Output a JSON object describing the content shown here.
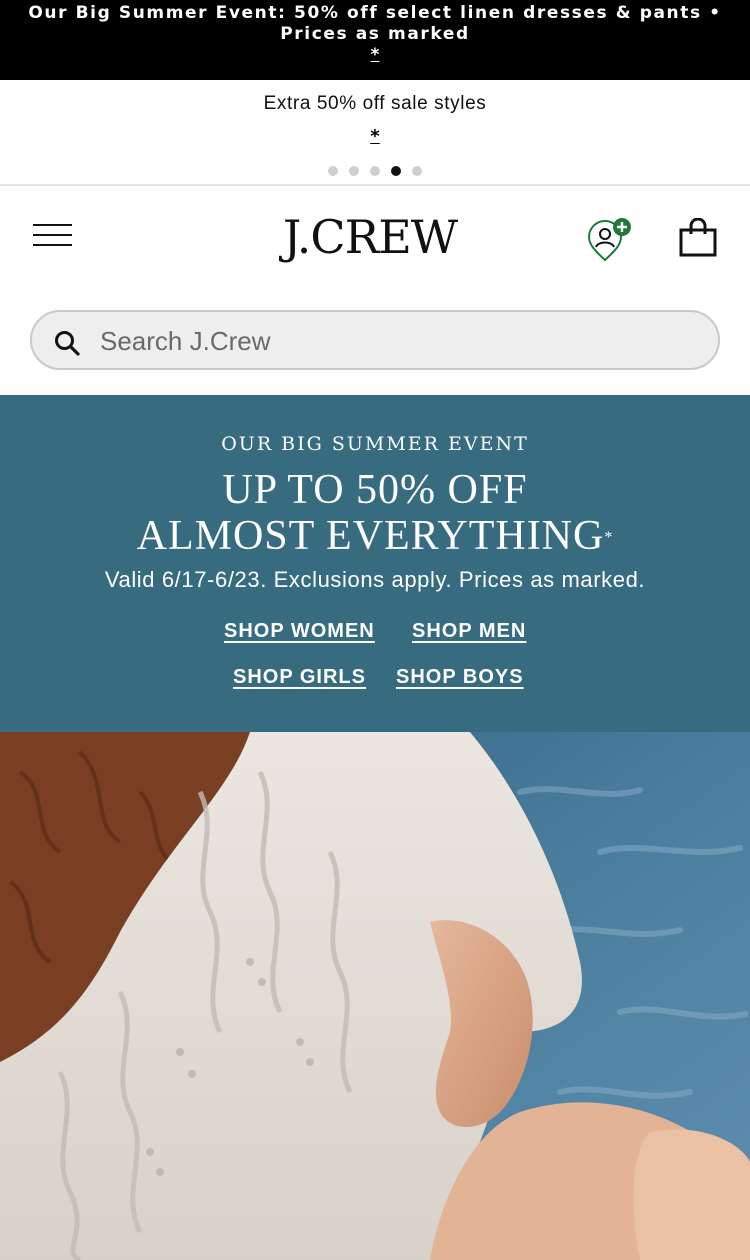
{
  "top_banner": {
    "line1": "Our Big Summer Event: 50% off select linen dresses & pants •",
    "line2": "Prices as marked",
    "asterisk": "*"
  },
  "carousel": {
    "message": "Extra 50% off sale styles",
    "asterisk": "*",
    "dots_total": 5,
    "active_dot": 4
  },
  "header": {
    "logo": "J.CREW",
    "menu_icon": "hamburger-menu-icon",
    "account_icon": "account-plus-icon",
    "bag_icon": "shopping-bag-icon"
  },
  "search": {
    "placeholder": "Search J.Crew",
    "icon": "search-icon"
  },
  "promo": {
    "eyebrow": "OUR BIG SUMMER EVENT",
    "headline_line1": "UP TO 50% OFF",
    "headline_line2": "ALMOST EVERYTHING",
    "headline_mark": "*",
    "valid_text": "Valid 6/17-6/23. Exclusions apply. Prices as marked.",
    "links": {
      "women": "SHOP WOMEN",
      "men": "SHOP MEN",
      "girls": "SHOP GIRLS",
      "boys": "SHOP BOYS"
    },
    "background_color": "#376b80"
  },
  "colors": {
    "accent_green": "#1d7a3a",
    "top_bar": "#000000"
  }
}
